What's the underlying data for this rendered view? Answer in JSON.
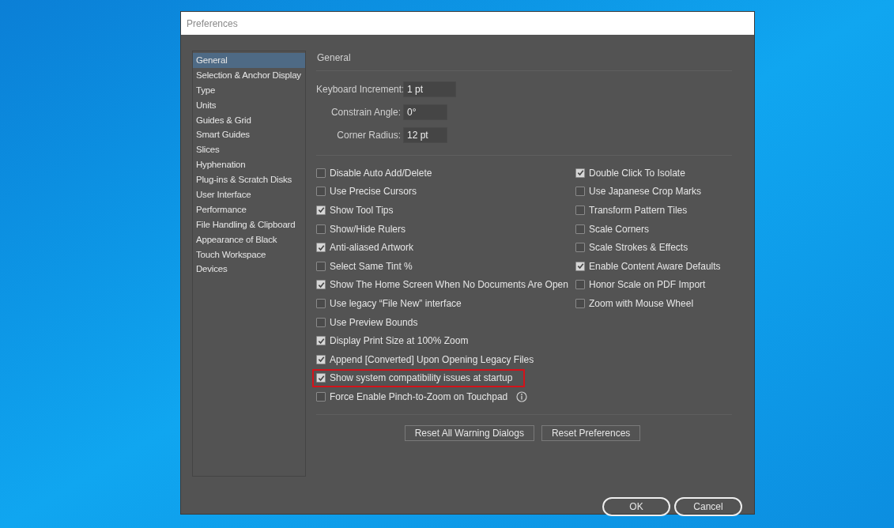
{
  "window": {
    "title": "Preferences"
  },
  "sidebar": {
    "items": [
      {
        "label": "General",
        "selected": true
      },
      {
        "label": "Selection & Anchor Display",
        "selected": false
      },
      {
        "label": "Type",
        "selected": false
      },
      {
        "label": "Units",
        "selected": false
      },
      {
        "label": "Guides & Grid",
        "selected": false
      },
      {
        "label": "Smart Guides",
        "selected": false
      },
      {
        "label": "Slices",
        "selected": false
      },
      {
        "label": "Hyphenation",
        "selected": false
      },
      {
        "label": "Plug-ins & Scratch Disks",
        "selected": false
      },
      {
        "label": "User Interface",
        "selected": false
      },
      {
        "label": "Performance",
        "selected": false
      },
      {
        "label": "File Handling & Clipboard",
        "selected": false
      },
      {
        "label": "Appearance of Black",
        "selected": false
      },
      {
        "label": "Touch Workspace",
        "selected": false
      },
      {
        "label": "Devices",
        "selected": false
      }
    ]
  },
  "section_title": "General",
  "fields": [
    {
      "label": "Keyboard Increment:",
      "value": "1 pt",
      "wide": true
    },
    {
      "label": "Constrain Angle:",
      "value": "0°",
      "wide": false
    },
    {
      "label": "Corner Radius:",
      "value": "12 pt",
      "wide": false
    }
  ],
  "options_left": [
    {
      "label": "Disable Auto Add/Delete",
      "checked": false,
      "highlighted": false,
      "info": false
    },
    {
      "label": "Use Precise Cursors",
      "checked": false,
      "highlighted": false,
      "info": false
    },
    {
      "label": "Show Tool Tips",
      "checked": true,
      "highlighted": false,
      "info": false
    },
    {
      "label": "Show/Hide Rulers",
      "checked": false,
      "highlighted": false,
      "info": false
    },
    {
      "label": "Anti-aliased Artwork",
      "checked": true,
      "highlighted": false,
      "info": false
    },
    {
      "label": "Select Same Tint %",
      "checked": false,
      "highlighted": false,
      "info": false
    },
    {
      "label": "Show The Home Screen When No Documents Are Open",
      "checked": true,
      "highlighted": false,
      "info": false
    },
    {
      "label": "Use legacy “File New” interface",
      "checked": false,
      "highlighted": false,
      "info": false
    },
    {
      "label": "Use Preview Bounds",
      "checked": false,
      "highlighted": false,
      "info": false
    },
    {
      "label": "Display Print Size at 100% Zoom",
      "checked": true,
      "highlighted": false,
      "info": false
    },
    {
      "label": "Append [Converted] Upon Opening Legacy Files",
      "checked": true,
      "highlighted": false,
      "info": false
    },
    {
      "label": "Show system compatibility issues at startup",
      "checked": true,
      "highlighted": true,
      "info": false
    },
    {
      "label": "Force Enable Pinch-to-Zoom on Touchpad",
      "checked": false,
      "highlighted": false,
      "info": true
    }
  ],
  "options_right": [
    {
      "label": "Double Click To Isolate",
      "checked": true
    },
    {
      "label": "Use Japanese Crop Marks",
      "checked": false
    },
    {
      "label": "Transform Pattern Tiles",
      "checked": false
    },
    {
      "label": "Scale Corners",
      "checked": false
    },
    {
      "label": "Scale Strokes & Effects",
      "checked": false
    },
    {
      "label": "Enable Content Aware Defaults",
      "checked": true
    },
    {
      "label": "Honor Scale on PDF Import",
      "checked": false
    },
    {
      "label": "Zoom with Mouse Wheel",
      "checked": false
    }
  ],
  "reset_buttons": [
    "Reset All Warning Dialogs",
    "Reset Preferences"
  ],
  "buttons": [
    "OK",
    "Cancel"
  ]
}
